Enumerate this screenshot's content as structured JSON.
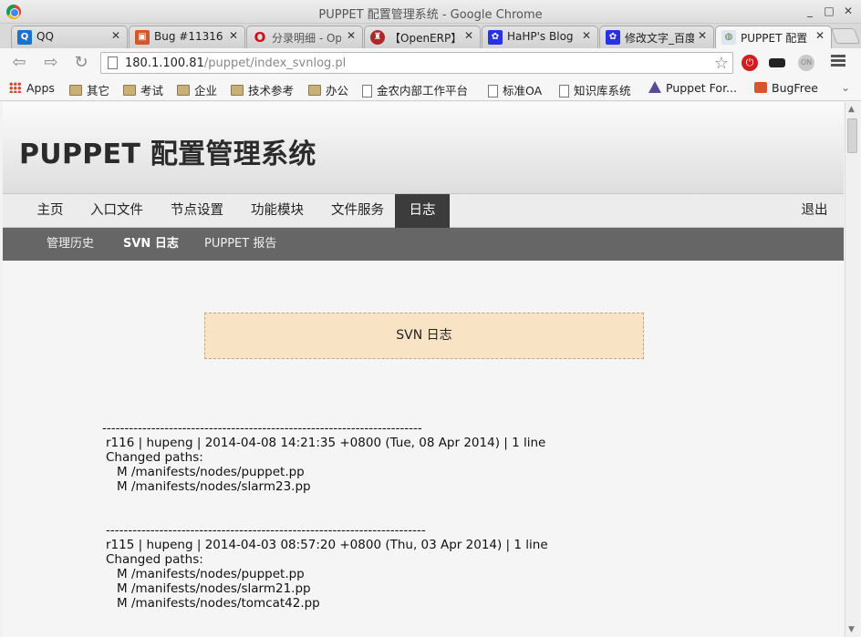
{
  "window": {
    "title": "PUPPET 配置管理系统 - Google Chrome"
  },
  "tabs": [
    {
      "label": "QQ",
      "favicon": "qq-icon",
      "color": "#1a73c8",
      "glyph": "Q"
    },
    {
      "label": "Bug #11316",
      "favicon": "redmine-icon",
      "color": "#d5562b",
      "glyph": "▣"
    },
    {
      "label": "分录明细 - Op",
      "favicon": "opera-icon",
      "color": "#ffffff",
      "glyph": "O"
    },
    {
      "label": "【OpenERP】",
      "favicon": "openerp-icon",
      "color": "#a82a2a",
      "glyph": "♜"
    },
    {
      "label": "HaHP's Blog",
      "favicon": "baidu-paw-icon",
      "color": "#2932e1",
      "glyph": "✿"
    },
    {
      "label": "修改文字_百度",
      "favicon": "baidu-paw-icon",
      "color": "#2932e1",
      "glyph": "✿"
    },
    {
      "label": "PUPPET 配置",
      "favicon": "puppet-page-icon",
      "color": "#dfe7ee",
      "glyph": "◍"
    }
  ],
  "toolbar": {
    "url_host": "180.1.100.81",
    "url_path": "/puppet/index_svnlog.pl"
  },
  "bookmarks": [
    {
      "label": "Apps",
      "icon": "apps-grid-icon"
    },
    {
      "label": "其它",
      "icon": "folder-icon"
    },
    {
      "label": "考试",
      "icon": "folder-icon"
    },
    {
      "label": "企业",
      "icon": "folder-icon"
    },
    {
      "label": "技术参考",
      "icon": "folder-icon"
    },
    {
      "label": "办公",
      "icon": "folder-icon"
    },
    {
      "label": "金农内部工作平台",
      "icon": "page-icon"
    },
    {
      "label": "标准OA",
      "icon": "page-icon"
    },
    {
      "label": "知识库系统",
      "icon": "page-icon"
    },
    {
      "label": "Puppet For...",
      "icon": "puppet-icon"
    },
    {
      "label": "BugFree",
      "icon": "bugfree-icon"
    }
  ],
  "page": {
    "site_title": "PUPPET 配置管理系统",
    "main_nav": [
      "主页",
      "入口文件",
      "节点设置",
      "功能模块",
      "文件服务",
      "日志"
    ],
    "main_nav_active": "日志",
    "logout": "退出",
    "sub_nav": [
      "管理历史",
      "SVN 日志",
      "PUPPET 报告"
    ],
    "sub_nav_active": "SVN 日志",
    "log_title": "SVN 日志",
    "log_entries": [
      {
        "separator": "------------------------------------------------------------------------",
        "header": "r116 | hupeng | 2014-04-08 14:21:35 +0800 (Tue, 08 Apr 2014) | 1 line",
        "changed_label": "Changed paths:",
        "paths": [
          "M /manifests/nodes/puppet.pp",
          "M /manifests/nodes/slarm23.pp"
        ]
      },
      {
        "separator": "------------------------------------------------------------------------",
        "header": "r115 | hupeng | 2014-04-03 08:57:20 +0800 (Thu, 03 Apr 2014) | 1 line",
        "changed_label": "Changed paths:",
        "paths": [
          "M /manifests/nodes/puppet.pp",
          "M /manifests/nodes/slarm21.pp",
          "M /manifests/nodes/tomcat42.pp"
        ]
      }
    ]
  }
}
